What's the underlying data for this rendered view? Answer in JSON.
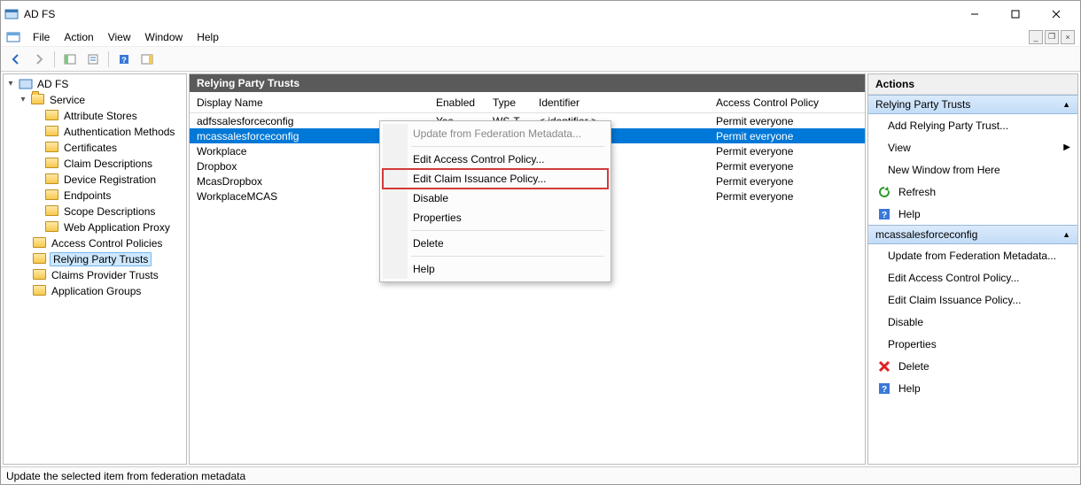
{
  "window": {
    "title": "AD FS"
  },
  "menu": {
    "file": "File",
    "action": "Action",
    "view": "View",
    "window": "Window",
    "help": "Help"
  },
  "tree": {
    "root": "AD FS",
    "service": "Service",
    "svc_children": [
      "Attribute Stores",
      "Authentication Methods",
      "Certificates",
      "Claim Descriptions",
      "Device Registration",
      "Endpoints",
      "Scope Descriptions",
      "Web Application Proxy"
    ],
    "siblings": [
      "Access Control Policies",
      "Relying Party Trusts",
      "Claims Provider Trusts",
      "Application Groups"
    ]
  },
  "content": {
    "header": "Relying Party Trusts",
    "cols": {
      "name": "Display Name",
      "enabled": "Enabled",
      "type": "Type",
      "id": "Identifier",
      "acp": "Access Control Policy"
    },
    "rows": [
      {
        "name": "adfssalesforceconfig",
        "enabled": "Yes",
        "type": "WS-T...",
        "id": "< identifier >",
        "acp": "Permit everyone"
      },
      {
        "name": "mcassalesforceconfig",
        "enabled": "",
        "type": "",
        "id": "",
        "acp": "Permit everyone",
        "selected": true
      },
      {
        "name": "Workplace",
        "enabled": "",
        "type": "",
        "id": "",
        "acp": "Permit everyone"
      },
      {
        "name": "Dropbox",
        "enabled": "",
        "type": "",
        "id": "",
        "acp": "Permit everyone"
      },
      {
        "name": "McasDropbox",
        "enabled": "",
        "type": "",
        "id": "",
        "acp": "Permit everyone"
      },
      {
        "name": "WorkplaceMCAS",
        "enabled": "",
        "type": "",
        "id": "",
        "acp": "Permit everyone"
      }
    ]
  },
  "context_menu": {
    "items": [
      "Update from Federation Metadata...",
      "Edit Access Control Policy...",
      "Edit Claim Issuance Policy...",
      "Disable",
      "Properties",
      "Delete",
      "Help"
    ]
  },
  "actions": {
    "header": "Actions",
    "group1": "Relying Party Trusts",
    "g1_items": {
      "add": "Add Relying Party Trust...",
      "view": "View",
      "newwin": "New Window from Here",
      "refresh": "Refresh",
      "help": "Help"
    },
    "group2": "mcassalesforceconfig",
    "g2_items": {
      "upd": "Update from Federation Metadata...",
      "eacp": "Edit Access Control Policy...",
      "ecip": "Edit Claim Issuance Policy...",
      "disable": "Disable",
      "props": "Properties",
      "delete": "Delete",
      "help": "Help"
    }
  },
  "status": "Update the selected item from federation metadata"
}
